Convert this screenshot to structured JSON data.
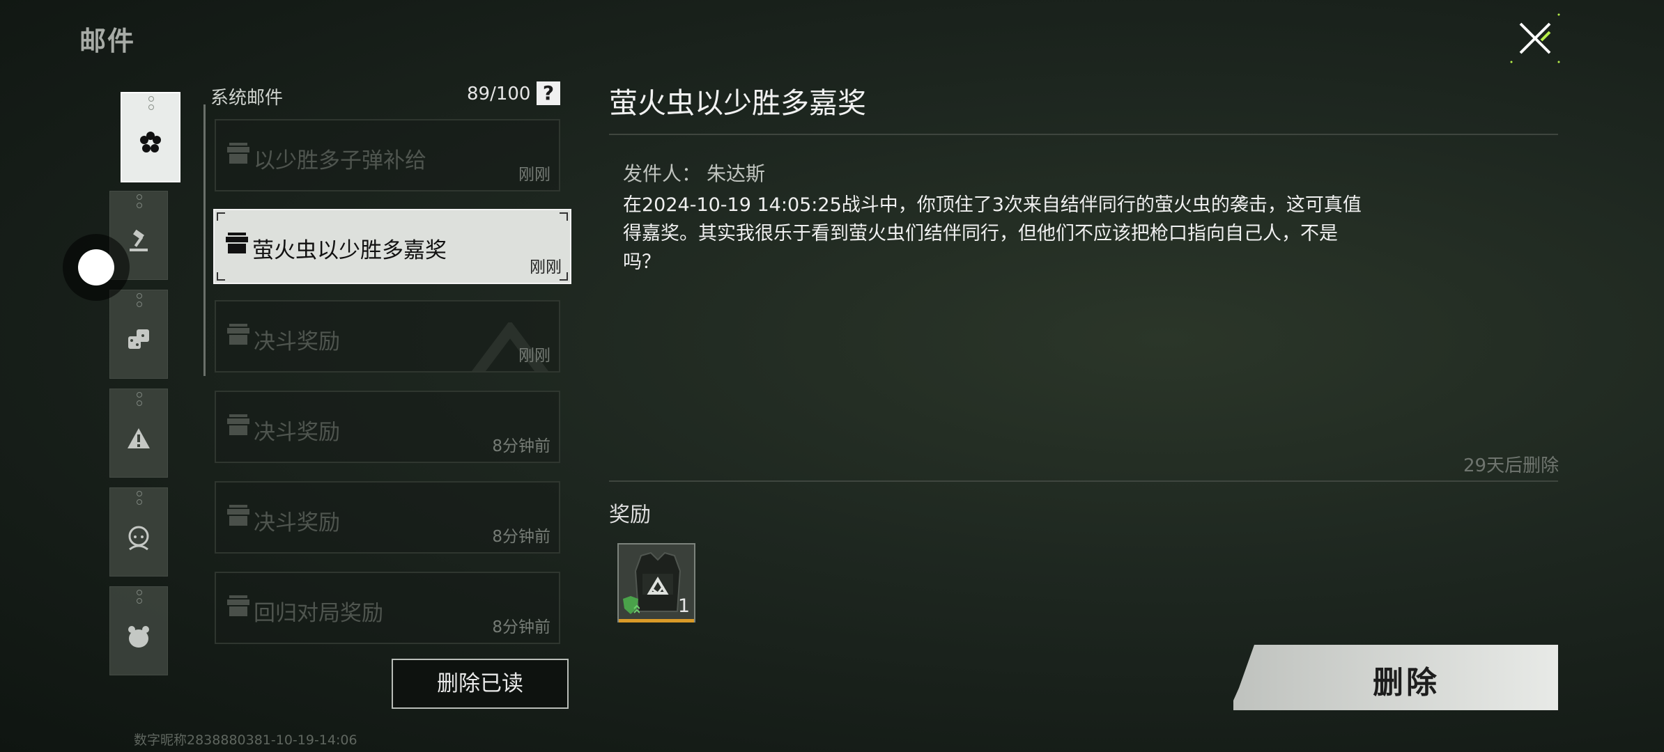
{
  "page": {
    "title": "邮件"
  },
  "list": {
    "header": "系统邮件",
    "count": "89/100",
    "help_glyph": "?",
    "items": [
      {
        "title": "以少胜多子弹补给",
        "time": "刚刚",
        "selected": false
      },
      {
        "title": "萤火虫以少胜多嘉奖",
        "time": "刚刚",
        "selected": true
      },
      {
        "title": "决斗奖励",
        "time": "刚刚",
        "selected": false
      },
      {
        "title": "决斗奖励",
        "time": "8分钟前",
        "selected": false
      },
      {
        "title": "决斗奖励",
        "time": "8分钟前",
        "selected": false
      },
      {
        "title": "回归对局奖励",
        "time": "8分钟前",
        "selected": false
      }
    ],
    "delete_read_label": "删除已读"
  },
  "detail": {
    "title": "萤火虫以少胜多嘉奖",
    "sender_label": "发件人：",
    "sender_name": "朱达斯",
    "body": "在2024-10-19 14:05:25战斗中，你顶住了3次来自结伴同行的萤火虫的袭击，这可真值得嘉奖。其实我很乐于看到萤火虫们结伴同行，但他们不应该把枪口指向自己人，不是吗？",
    "expire_text": "29天后删除",
    "reward_label": "奖励",
    "rewards": [
      {
        "icon": "vest-icon",
        "count": "1",
        "rarity_color": "#d99a28"
      }
    ],
    "delete_label": "删除"
  },
  "categories": [
    {
      "icon": "flower-icon",
      "active": true
    },
    {
      "icon": "gavel-icon",
      "active": false
    },
    {
      "icon": "dice-icon",
      "active": false
    },
    {
      "icon": "warning-icon",
      "active": false
    },
    {
      "icon": "person-icon",
      "active": false
    },
    {
      "icon": "bear-icon",
      "active": false
    }
  ],
  "footer": {
    "text": "数字昵称2838880381-10-19-14:06"
  },
  "colors": {
    "accent_green": "#b8f04a",
    "reward_rarity": "#d99a28"
  }
}
